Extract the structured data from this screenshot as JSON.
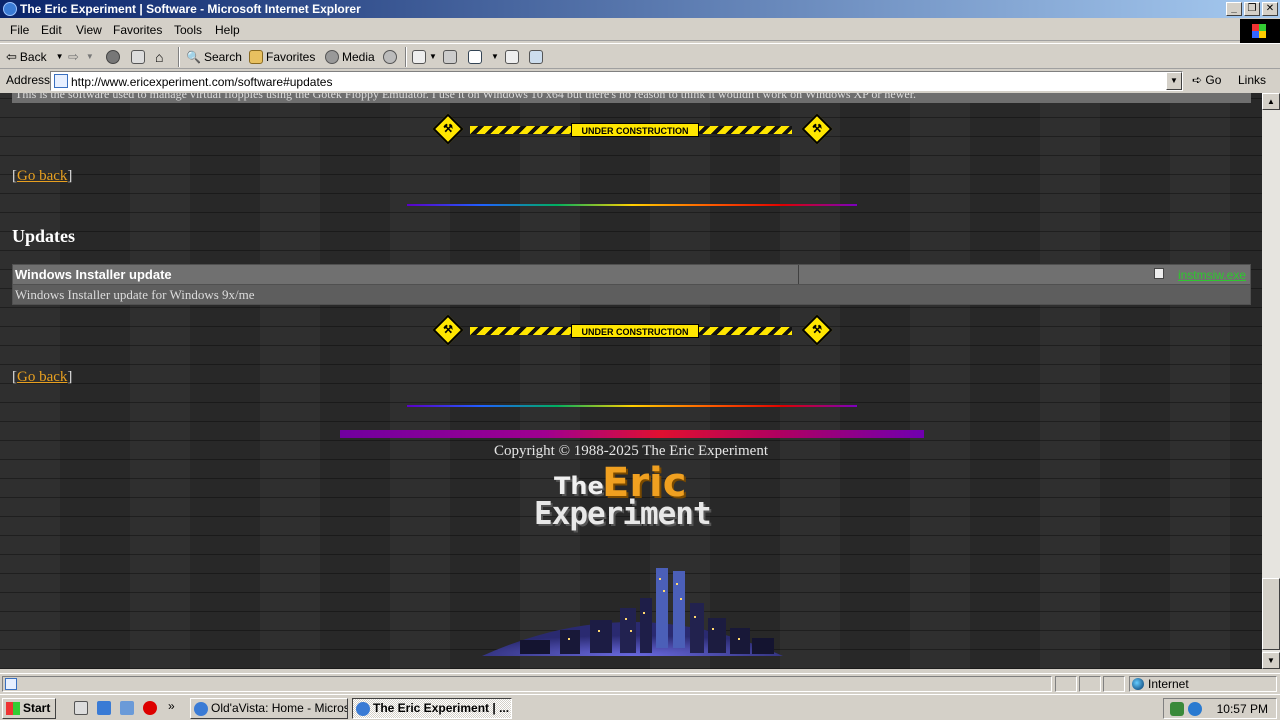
{
  "window": {
    "title": "The Eric Experiment | Software - Microsoft Internet Explorer",
    "minimize": "_",
    "maximize": "❐",
    "close": "✕"
  },
  "menu": [
    "File",
    "Edit",
    "View",
    "Favorites",
    "Tools",
    "Help"
  ],
  "toolbar": {
    "back": "Back",
    "search": "Search",
    "favorites": "Favorites",
    "media": "Media"
  },
  "address": {
    "label": "Address",
    "url": "http://www.ericexperiment.com/software#updates",
    "go": "Go",
    "links": "Links"
  },
  "page": {
    "previous_description": "This is the software used to manage virtual floppies using the Gotek Floppy Emulator. I use it on Windows 10 x64 but there's no reason to think it wouldn't work on Windows XP or newer.",
    "construction_label": "UNDER CONSTRUCTION",
    "go_back": "Go back",
    "bracket_open": "[",
    "bracket_close": "]",
    "section_title": "Updates",
    "update": {
      "name": "Windows Installer update",
      "download": "instmsiw.exe",
      "description": "Windows Installer update for Windows 9x/me"
    },
    "copyright": "Copyright © 1988-2025 The Eric Experiment",
    "logo": {
      "the": "The",
      "eric": "Eric",
      "experiment": "Experiment"
    }
  },
  "statusbar": {
    "zone": "Internet"
  },
  "taskbar": {
    "start": "Start",
    "tasks": [
      {
        "label": "Old'aVista: Home - Micros...",
        "active": false
      },
      {
        "label": "The Eric Experiment | ...",
        "active": true
      }
    ],
    "chevron": "»",
    "clock": "10:57 PM"
  },
  "colors": {
    "link": "#e8a020",
    "download_link": "#2ec82e",
    "titlebar_start": "#0a246a",
    "titlebar_end": "#a6caf0"
  }
}
